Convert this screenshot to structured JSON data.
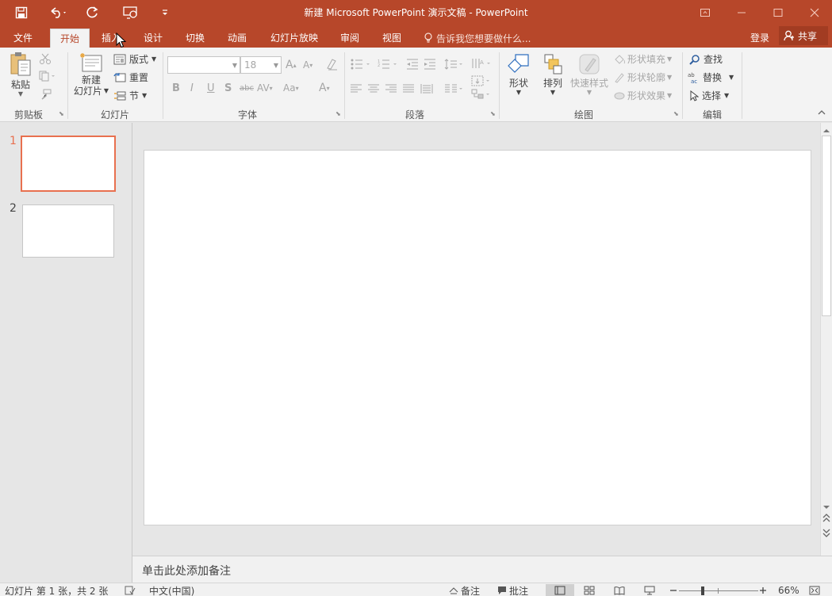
{
  "titlebar": {
    "title": "新建 Microsoft PowerPoint 演示文稿 - PowerPoint",
    "icons": [
      "save-icon",
      "undo-icon",
      "redo-icon",
      "start-presentation-icon",
      "customize-qat-icon",
      "ribbon-display-icon",
      "minimize-icon",
      "maximize-icon",
      "close-icon"
    ]
  },
  "tabs": [
    "文件",
    "开始",
    "插入",
    "设计",
    "切换",
    "动画",
    "幻灯片放映",
    "审阅",
    "视图"
  ],
  "active_tab": "开始",
  "tell_me": "告诉我您想要做什么...",
  "login": "登录",
  "share": "共享",
  "ribbon": {
    "clipboard": {
      "label": "剪贴板",
      "paste": "粘贴"
    },
    "slides": {
      "label": "幻灯片",
      "new_slide_1": "新建",
      "new_slide_2": "幻灯片",
      "layout": "版式",
      "reset": "重置",
      "section": "节"
    },
    "font": {
      "label": "字体",
      "font_name": "",
      "font_size": "18"
    },
    "paragraph": {
      "label": "段落"
    },
    "drawing": {
      "label": "绘图",
      "shapes": "形状",
      "arrange": "排列",
      "quick_styles": "快速样式",
      "shape_fill": "形状填充",
      "shape_outline": "形状轮廓",
      "shape_effects": "形状效果"
    },
    "editing": {
      "label": "编辑",
      "find": "查找",
      "replace": "替换",
      "select": "选择"
    }
  },
  "slides": [
    {
      "number": "1",
      "selected": true
    },
    {
      "number": "2",
      "selected": false
    }
  ],
  "notes_placeholder": "单击此处添加备注",
  "status": {
    "slide_info": "幻灯片 第 1 张，共 2 张",
    "language": "中文(中国)",
    "notes": "备注",
    "comments": "批注",
    "zoom": "66%"
  },
  "colors": {
    "accent": "#b7472a",
    "selected_slide_border": "#e8704f"
  }
}
